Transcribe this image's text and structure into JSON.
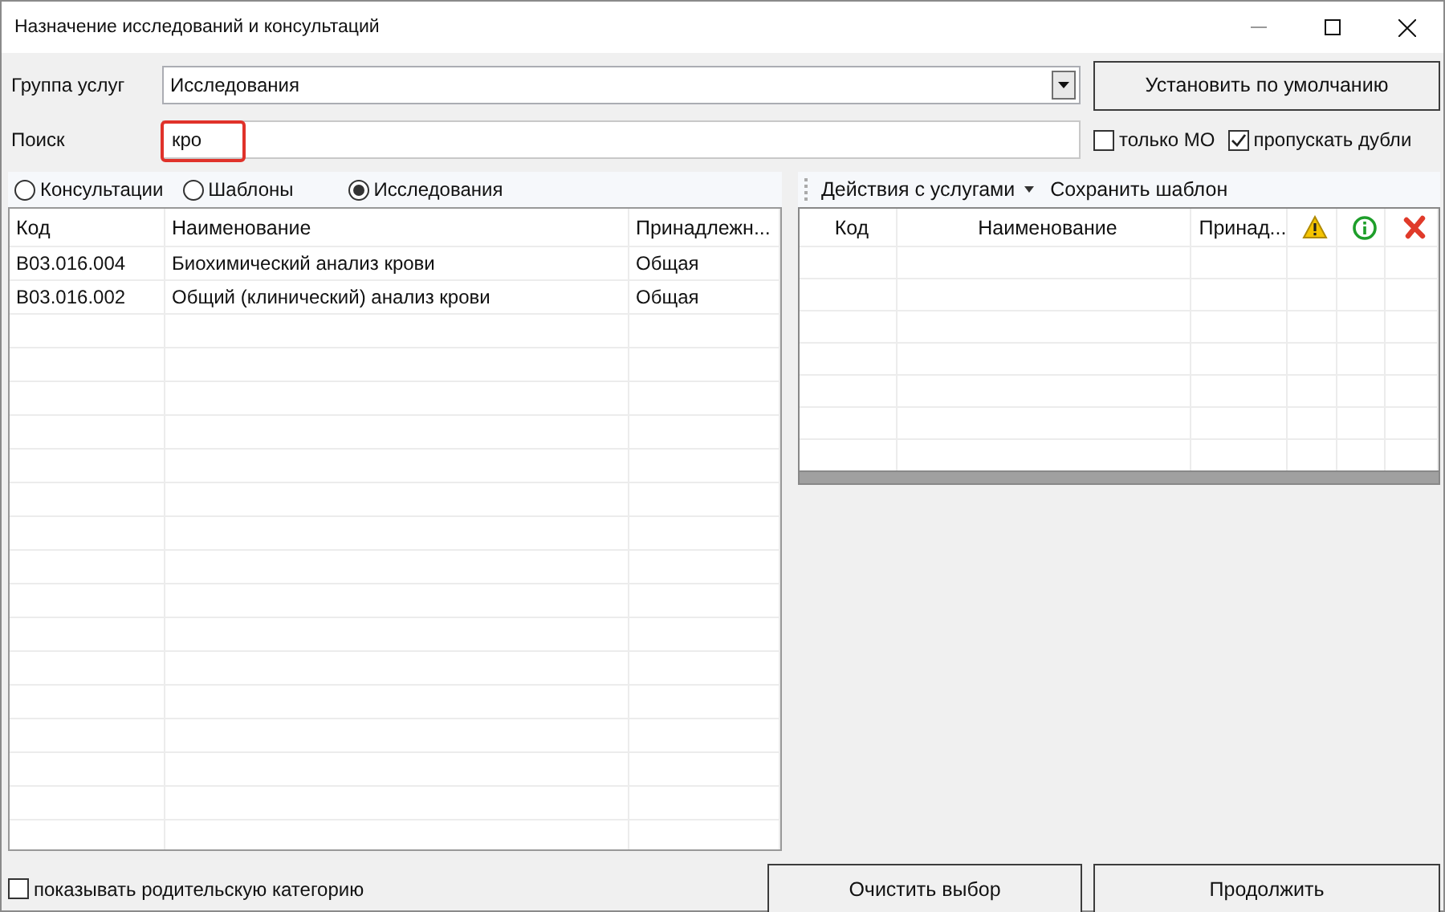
{
  "window": {
    "title": "Назначение исследований и консультаций"
  },
  "service_group": {
    "label": "Группа услуг",
    "value": "Исследования"
  },
  "default_button": "Установить по умолчанию",
  "search": {
    "label": "Поиск",
    "value": "кро",
    "highlighted": true
  },
  "filters": [
    {
      "label": "только МО",
      "checked": false
    },
    {
      "label": "пропускать дубли",
      "checked": true
    }
  ],
  "categories": [
    {
      "label": "Консультации",
      "selected": false
    },
    {
      "label": "Шаблоны",
      "selected": false
    },
    {
      "label": "Исследования",
      "selected": true
    }
  ],
  "services_table": {
    "columns": [
      "Код",
      "Наименование",
      "Принадлежн..."
    ],
    "rows": [
      [
        "B03.016.004",
        "Биохимический анализ крови",
        "Общая"
      ],
      [
        "B03.016.002",
        "Общий (клинический) анализ крови",
        "Общая"
      ]
    ]
  },
  "selected_toolbar": [
    {
      "label": "Действия с услугами",
      "kind": "menu"
    },
    {
      "label": "Сохранить шаблон",
      "kind": "button"
    }
  ],
  "selected_table": {
    "columns": [
      {
        "kind": "text",
        "label": "Код"
      },
      {
        "kind": "text",
        "label": "Наименование"
      },
      {
        "kind": "text",
        "label": "Принад..."
      },
      {
        "kind": "warning"
      },
      {
        "kind": "info"
      },
      {
        "kind": "delete"
      }
    ]
  },
  "show_parent_category": {
    "label": "показывать родительскую категорию",
    "checked": false
  },
  "buttons": [
    "Очистить выбор",
    "Продолжить"
  ]
}
